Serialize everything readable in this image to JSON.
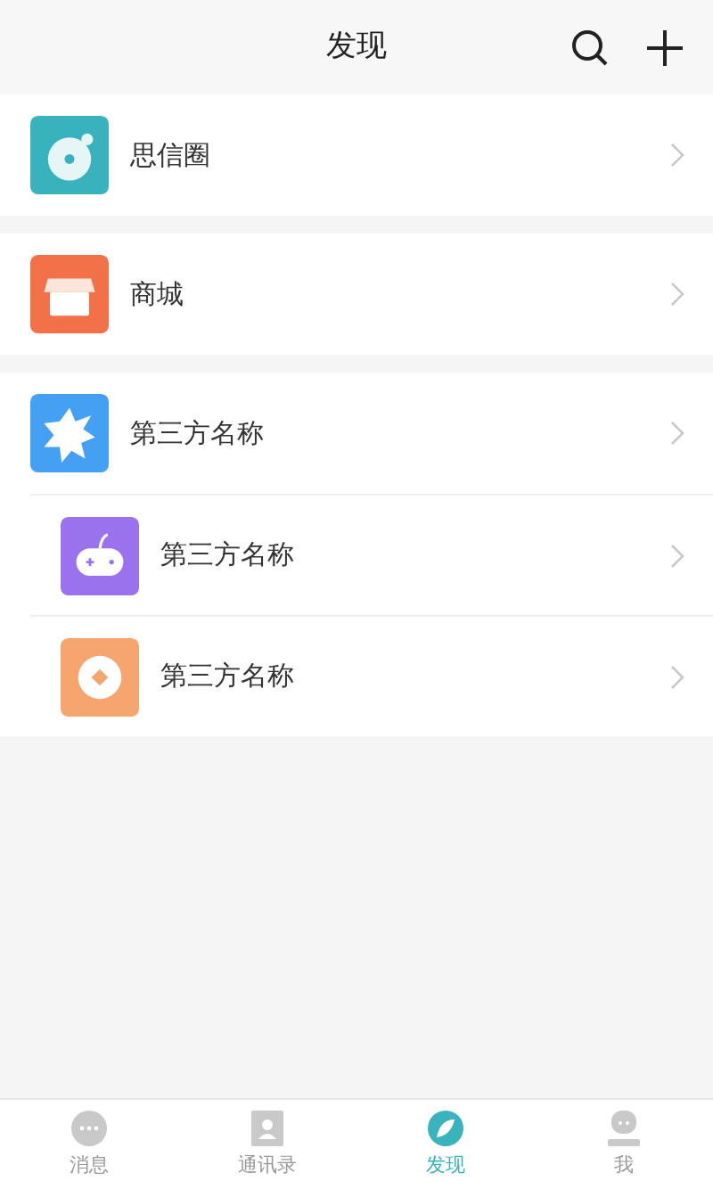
{
  "header": {
    "title": "发现"
  },
  "groups": [
    {
      "items": [
        {
          "label": "思信圈",
          "kind": "disc",
          "color": "#38b2bd"
        }
      ]
    },
    {
      "items": [
        {
          "label": "商城",
          "kind": "shop",
          "color": "#f37149"
        }
      ]
    },
    {
      "items": [
        {
          "label": "第三方名称",
          "kind": "sun",
          "color": "#44a0f3"
        },
        {
          "label": "第三方名称",
          "kind": "gamepad",
          "color": "#9a72ee"
        },
        {
          "label": "第三方名称",
          "kind": "coin",
          "color": "#f7a56e"
        }
      ]
    }
  ],
  "tabs": [
    {
      "label": "消息",
      "kind": "chat",
      "selected": false
    },
    {
      "label": "通讯录",
      "kind": "contacts",
      "selected": false
    },
    {
      "label": "发现",
      "kind": "discover",
      "selected": true
    },
    {
      "label": "我",
      "kind": "me",
      "selected": false
    }
  ]
}
